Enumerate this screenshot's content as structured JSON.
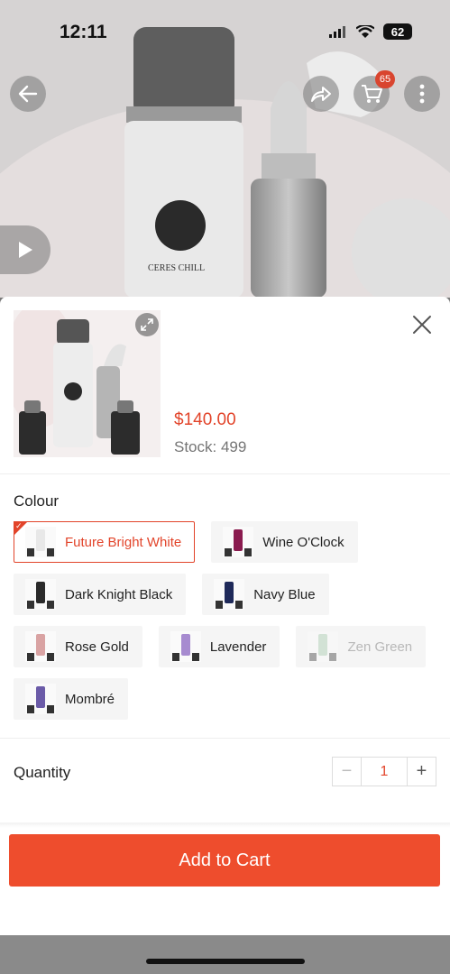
{
  "status": {
    "time": "12:11",
    "battery": "62"
  },
  "header": {
    "cart_count": "65"
  },
  "product": {
    "price": "$140.00",
    "stock_label": "Stock: 499"
  },
  "colour": {
    "title": "Colour",
    "options": [
      {
        "label": "Future Bright White",
        "state": "selected",
        "color": "#e8e8e8"
      },
      {
        "label": "Wine O'Clock",
        "state": "normal",
        "color": "#8a1b4f"
      },
      {
        "label": "Dark Knight Black",
        "state": "normal",
        "color": "#2b2b2b"
      },
      {
        "label": "Navy Blue",
        "state": "normal",
        "color": "#1f2a5a"
      },
      {
        "label": "Rose Gold",
        "state": "normal",
        "color": "#d9a3a3"
      },
      {
        "label": "Lavender",
        "state": "normal",
        "color": "#a78bd0"
      },
      {
        "label": "Zen Green",
        "state": "disabled",
        "color": "#9fc7a6"
      },
      {
        "label": "Mombré",
        "state": "normal",
        "color": "#6b5ba8"
      }
    ]
  },
  "quantity": {
    "label": "Quantity",
    "value": "1",
    "minus": "−",
    "plus": "+"
  },
  "actions": {
    "add_to_cart": "Add to Cart"
  },
  "colors": {
    "accent": "#ee4d2d",
    "price": "#e2442a"
  }
}
